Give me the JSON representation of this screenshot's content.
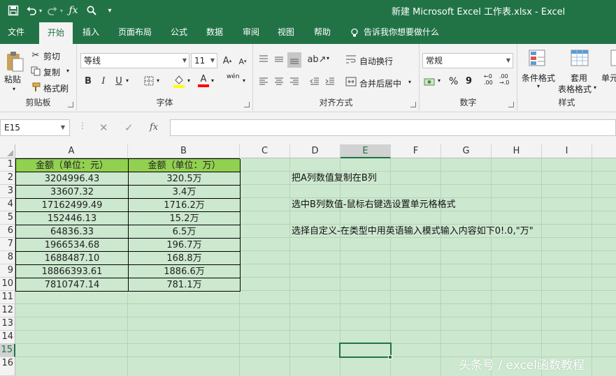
{
  "window": {
    "title": "新建 Microsoft Excel 工作表.xlsx  -  Excel"
  },
  "quick_access": {
    "items": [
      "save-icon",
      "undo-icon",
      "redo-icon",
      "fx-icon",
      "search-icon",
      "customize-icon"
    ]
  },
  "tabs": [
    "文件",
    "开始",
    "插入",
    "页面布局",
    "公式",
    "数据",
    "审阅",
    "视图",
    "帮助"
  ],
  "active_tab": "开始",
  "tell_me": "告诉我你想要做什么",
  "ribbon": {
    "clipboard": {
      "paste": "粘贴",
      "cut": "剪切",
      "copy": "复制",
      "format_painter": "格式刷",
      "label": "剪贴板"
    },
    "font": {
      "name": "等线",
      "size": "11",
      "label": "字体",
      "bold": "B",
      "italic": "I",
      "underline": "U",
      "phonetic": "wén"
    },
    "alignment": {
      "wrap": "自动换行",
      "merge": "合并后居中",
      "label": "对齐方式"
    },
    "number": {
      "format": "常规",
      "percent": "%",
      "comma": "9",
      "label": "数字",
      "inc_decimal": ".00",
      "dec_decimal": ".0"
    },
    "styles": {
      "conditional": "条件格式",
      "table_format_1": "套用",
      "table_format_2": "表格格式",
      "cell_styles": "单元",
      "label": "样式"
    }
  },
  "formula_bar": {
    "name_box": "E15",
    "formula": "",
    "cancel": "✕",
    "enter": "✓",
    "fx": "fx"
  },
  "columns": [
    "A",
    "B",
    "C",
    "D",
    "E",
    "F",
    "G",
    "H",
    "I"
  ],
  "rows": [
    "1",
    "2",
    "3",
    "4",
    "5",
    "6",
    "7",
    "8",
    "9",
    "10",
    "11",
    "12",
    "13",
    "14",
    "15",
    "16"
  ],
  "table": {
    "header_a": "金额（单位：元）",
    "header_b": "金额（单位：万）",
    "col_a": [
      "3204996.43",
      "33607.32",
      "17162499.49",
      "152446.13",
      "64836.33",
      "1966534.68",
      "1688487.10",
      "18866393.61",
      "7810747.14"
    ],
    "col_b": [
      "320.5万",
      "3.4万",
      "1716.2万",
      "15.2万",
      "6.5万",
      "196.7万",
      "168.8万",
      "1886.6万",
      "781.1万"
    ]
  },
  "notes": {
    "d2": "把A列数值复制在B列",
    "d4": "选中B列数值-鼠标右键选设置单元格格式",
    "d6": "选择自定义-在类型中用英语输入模式输入内容如下0!.0,\"万\""
  },
  "selected_cell": "E15",
  "watermark": "头条号 / excel函数教程",
  "colors": {
    "brand": "#217346",
    "header_fill": "#92d050",
    "sheet_bg": "#cce8cf"
  }
}
